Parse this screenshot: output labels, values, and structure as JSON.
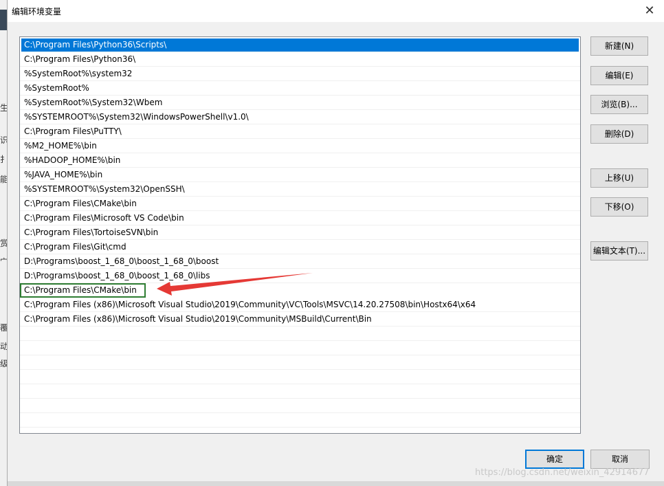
{
  "dialog": {
    "title": "编辑环境变量",
    "close_label": "✕"
  },
  "entries": [
    "C:\\Program Files\\Python36\\Scripts\\",
    "C:\\Program Files\\Python36\\",
    "%SystemRoot%\\system32",
    "%SystemRoot%",
    "%SystemRoot%\\System32\\Wbem",
    "%SYSTEMROOT%\\System32\\WindowsPowerShell\\v1.0\\",
    "C:\\Program Files\\PuTTY\\",
    "%M2_HOME%\\bin",
    "%HADOOP_HOME%\\bin",
    "%JAVA_HOME%\\bin",
    "%SYSTEMROOT%\\System32\\OpenSSH\\",
    "C:\\Program Files\\CMake\\bin",
    "C:\\Program Files\\Microsoft VS Code\\bin",
    "C:\\Program Files\\TortoiseSVN\\bin",
    "C:\\Program Files\\Git\\cmd",
    "D:\\Programs\\boost_1_68_0\\boost_1_68_0\\boost",
    "D:\\Programs\\boost_1_68_0\\boost_1_68_0\\libs",
    "C:\\Program Files\\CMake\\bin",
    "C:\\Program Files (x86)\\Microsoft Visual Studio\\2019\\Community\\VC\\Tools\\MSVC\\14.20.27508\\bin\\Hostx64\\x64",
    "C:\\Program Files (x86)\\Microsoft Visual Studio\\2019\\Community\\MSBuild\\Current\\Bin"
  ],
  "selected_index": 0,
  "highlighted_index": 17,
  "empty_rows": 7,
  "buttons": {
    "new": "新建(N)",
    "edit": "编辑(E)",
    "browse": "浏览(B)...",
    "delete": "删除(D)",
    "move_up": "上移(U)",
    "move_down": "下移(O)",
    "edit_text": "编辑文本(T)...",
    "ok": "确定",
    "cancel": "取消"
  },
  "watermark": "https://blog.csdn.net/weixin_42914677",
  "background_glyphs": [
    "生",
    "识",
    "扌",
    "能",
    "赏",
    "宀",
    "覆",
    "动",
    "级"
  ],
  "colors": {
    "selection": "#0078d7",
    "highlight_box": "#2e7d32",
    "arrow": "#e53935"
  }
}
